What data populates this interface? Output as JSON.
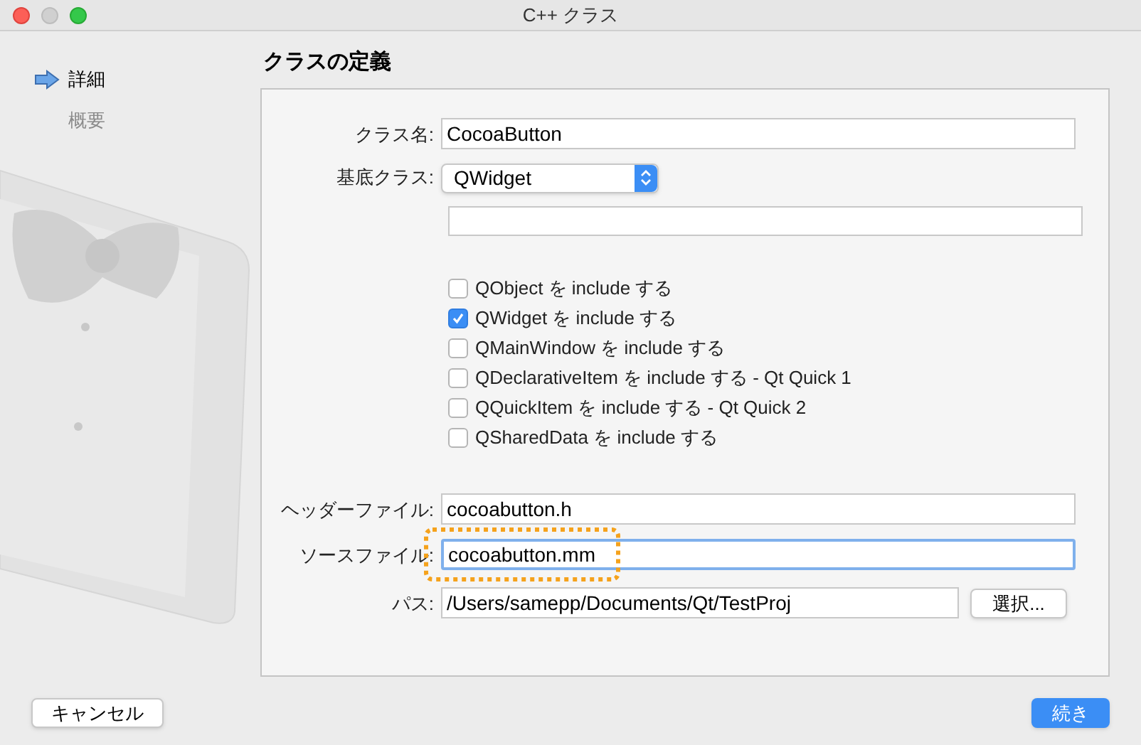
{
  "window": {
    "title": "C++ クラス"
  },
  "steps": [
    {
      "label": "詳細",
      "selected": true
    },
    {
      "label": "概要",
      "selected": false
    }
  ],
  "heading": "クラスの定義",
  "class_name": {
    "label": "クラス名:",
    "value": "CocoaButton"
  },
  "base_class": {
    "label": "基底クラス:",
    "value": "QWidget"
  },
  "includes": [
    {
      "label": "QObject を include する",
      "checked": false
    },
    {
      "label": "QWidget を include する",
      "checked": true
    },
    {
      "label": "QMainWindow を include する",
      "checked": false
    },
    {
      "label": "QDeclarativeItem を include する - Qt Quick 1",
      "checked": false
    },
    {
      "label": "QQuickItem を include する - Qt Quick 2",
      "checked": false
    },
    {
      "label": "QSharedData を include する",
      "checked": false
    }
  ],
  "header_file": {
    "label": "ヘッダーファイル:",
    "value": "cocoabutton.h",
    "focused": false,
    "highlighted": false
  },
  "source_file": {
    "label": "ソースファイル:",
    "value": "cocoabutton.mm",
    "focused": true,
    "highlighted": true
  },
  "path": {
    "label": "パス:",
    "value": "/Users/samepp/Documents/Qt/TestProj"
  },
  "browse_button": "選択...",
  "cancel_button": "キャンセル",
  "continue_button": "続き"
}
